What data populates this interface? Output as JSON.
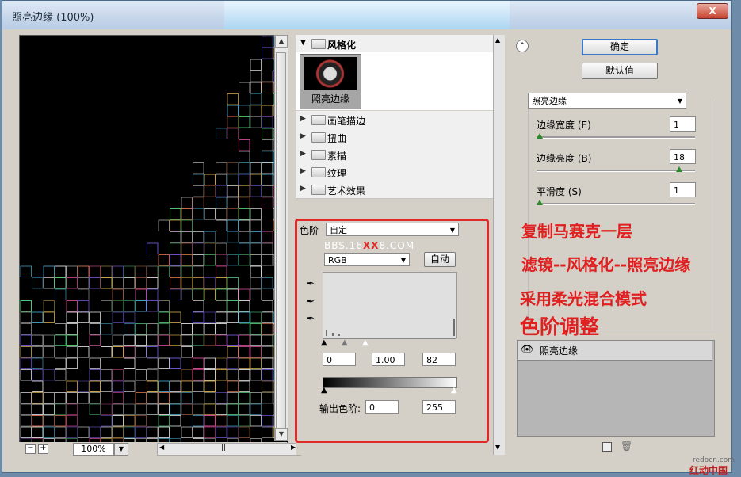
{
  "window": {
    "title": "照亮边缘 (100%)",
    "close_label": "X"
  },
  "preview": {
    "zoom": "100%",
    "zoom_minus": "−",
    "zoom_plus": "+",
    "scroll_grip": "|||"
  },
  "gallery": {
    "open_category": "风格化",
    "selected_filter": "照亮边缘",
    "categories": [
      "画笔描边",
      "扭曲",
      "素描",
      "纹理",
      "艺术效果"
    ]
  },
  "levels": {
    "channel_label": "色阶",
    "preset": "自定",
    "channel": "RGB",
    "auto_label": "自动",
    "watermark": "BBS.16",
    "watermark_red": "XX",
    "watermark_tail": "8.COM",
    "input_black": "0",
    "input_gamma": "1.00",
    "input_white": "82",
    "output_label": "输出色阶:",
    "output_black": "0",
    "output_white": "255"
  },
  "right": {
    "ok_label": "确定",
    "default_label": "默认值",
    "filter_name": "照亮边缘",
    "params": [
      {
        "label": "边缘宽度 (E)",
        "value": "1",
        "level": 0.0
      },
      {
        "label": "边缘亮度 (B)",
        "value": "18",
        "level": 0.9
      },
      {
        "label": "平滑度 (S)",
        "value": "1",
        "level": 0.0
      }
    ],
    "layer_name": "照亮边缘"
  },
  "annotations": [
    "复制马赛克一层",
    "滤镜--风格化--照亮边缘",
    "采用柔光混合模式",
    "色阶调整"
  ],
  "watermark": {
    "url": "redocn.com",
    "logo": "红动中国"
  },
  "colors": {
    "accent_red": "#e02a2a",
    "ok_border": "#3c78c8",
    "slider_knob": "#2a8a2a"
  }
}
